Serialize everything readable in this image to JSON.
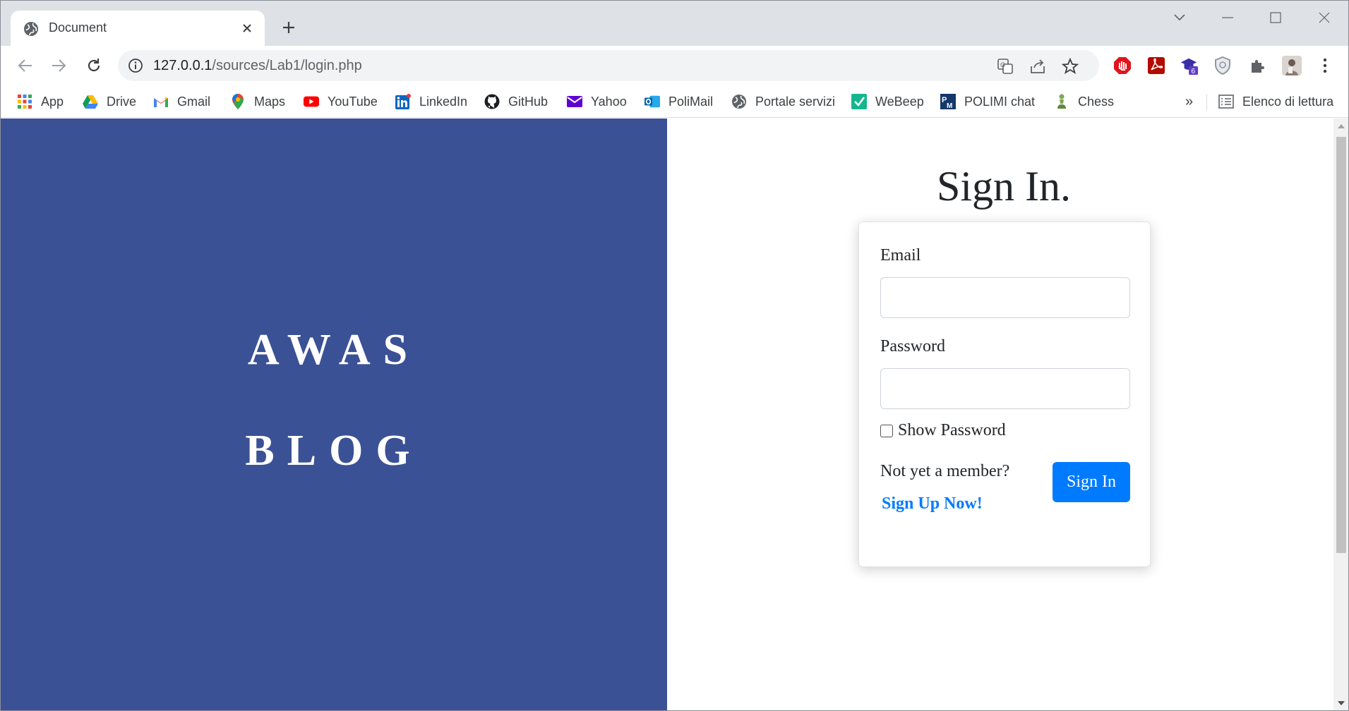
{
  "browser": {
    "tab_title": "Document",
    "url_host": "127.0.0.1",
    "url_path": "/sources/Lab1/login.php",
    "bookmarks": [
      {
        "label": "App",
        "icon": "apps-grid-icon"
      },
      {
        "label": "Drive",
        "icon": "drive-icon"
      },
      {
        "label": "Gmail",
        "icon": "gmail-icon"
      },
      {
        "label": "Maps",
        "icon": "maps-icon"
      },
      {
        "label": "YouTube",
        "icon": "youtube-icon"
      },
      {
        "label": "LinkedIn",
        "icon": "linkedin-icon"
      },
      {
        "label": "GitHub",
        "icon": "github-icon"
      },
      {
        "label": "Yahoo",
        "icon": "yahoo-mail-icon"
      },
      {
        "label": "PoliMail",
        "icon": "outlook-icon"
      },
      {
        "label": "Portale servizi",
        "icon": "globe-icon"
      },
      {
        "label": "WeBeep",
        "icon": "webeep-icon"
      },
      {
        "label": "POLIMI chat",
        "icon": "polimi-icon"
      },
      {
        "label": "Chess",
        "icon": "chess-pawn-icon"
      }
    ],
    "more_bookmarks": "»",
    "reading_list": "Elenco di lettura",
    "extension_badge": "6"
  },
  "page": {
    "brand_line1": "AWAS",
    "brand_line2": "BLOG",
    "heading": "Sign In.",
    "email_label": "Email",
    "password_label": "Password",
    "show_password_label": "Show Password",
    "member_prompt": "Not yet a member?",
    "signup_link": "Sign Up Now!",
    "signin_button": "Sign In"
  },
  "colors": {
    "left_panel": "#3b5196",
    "primary": "#007bff"
  }
}
